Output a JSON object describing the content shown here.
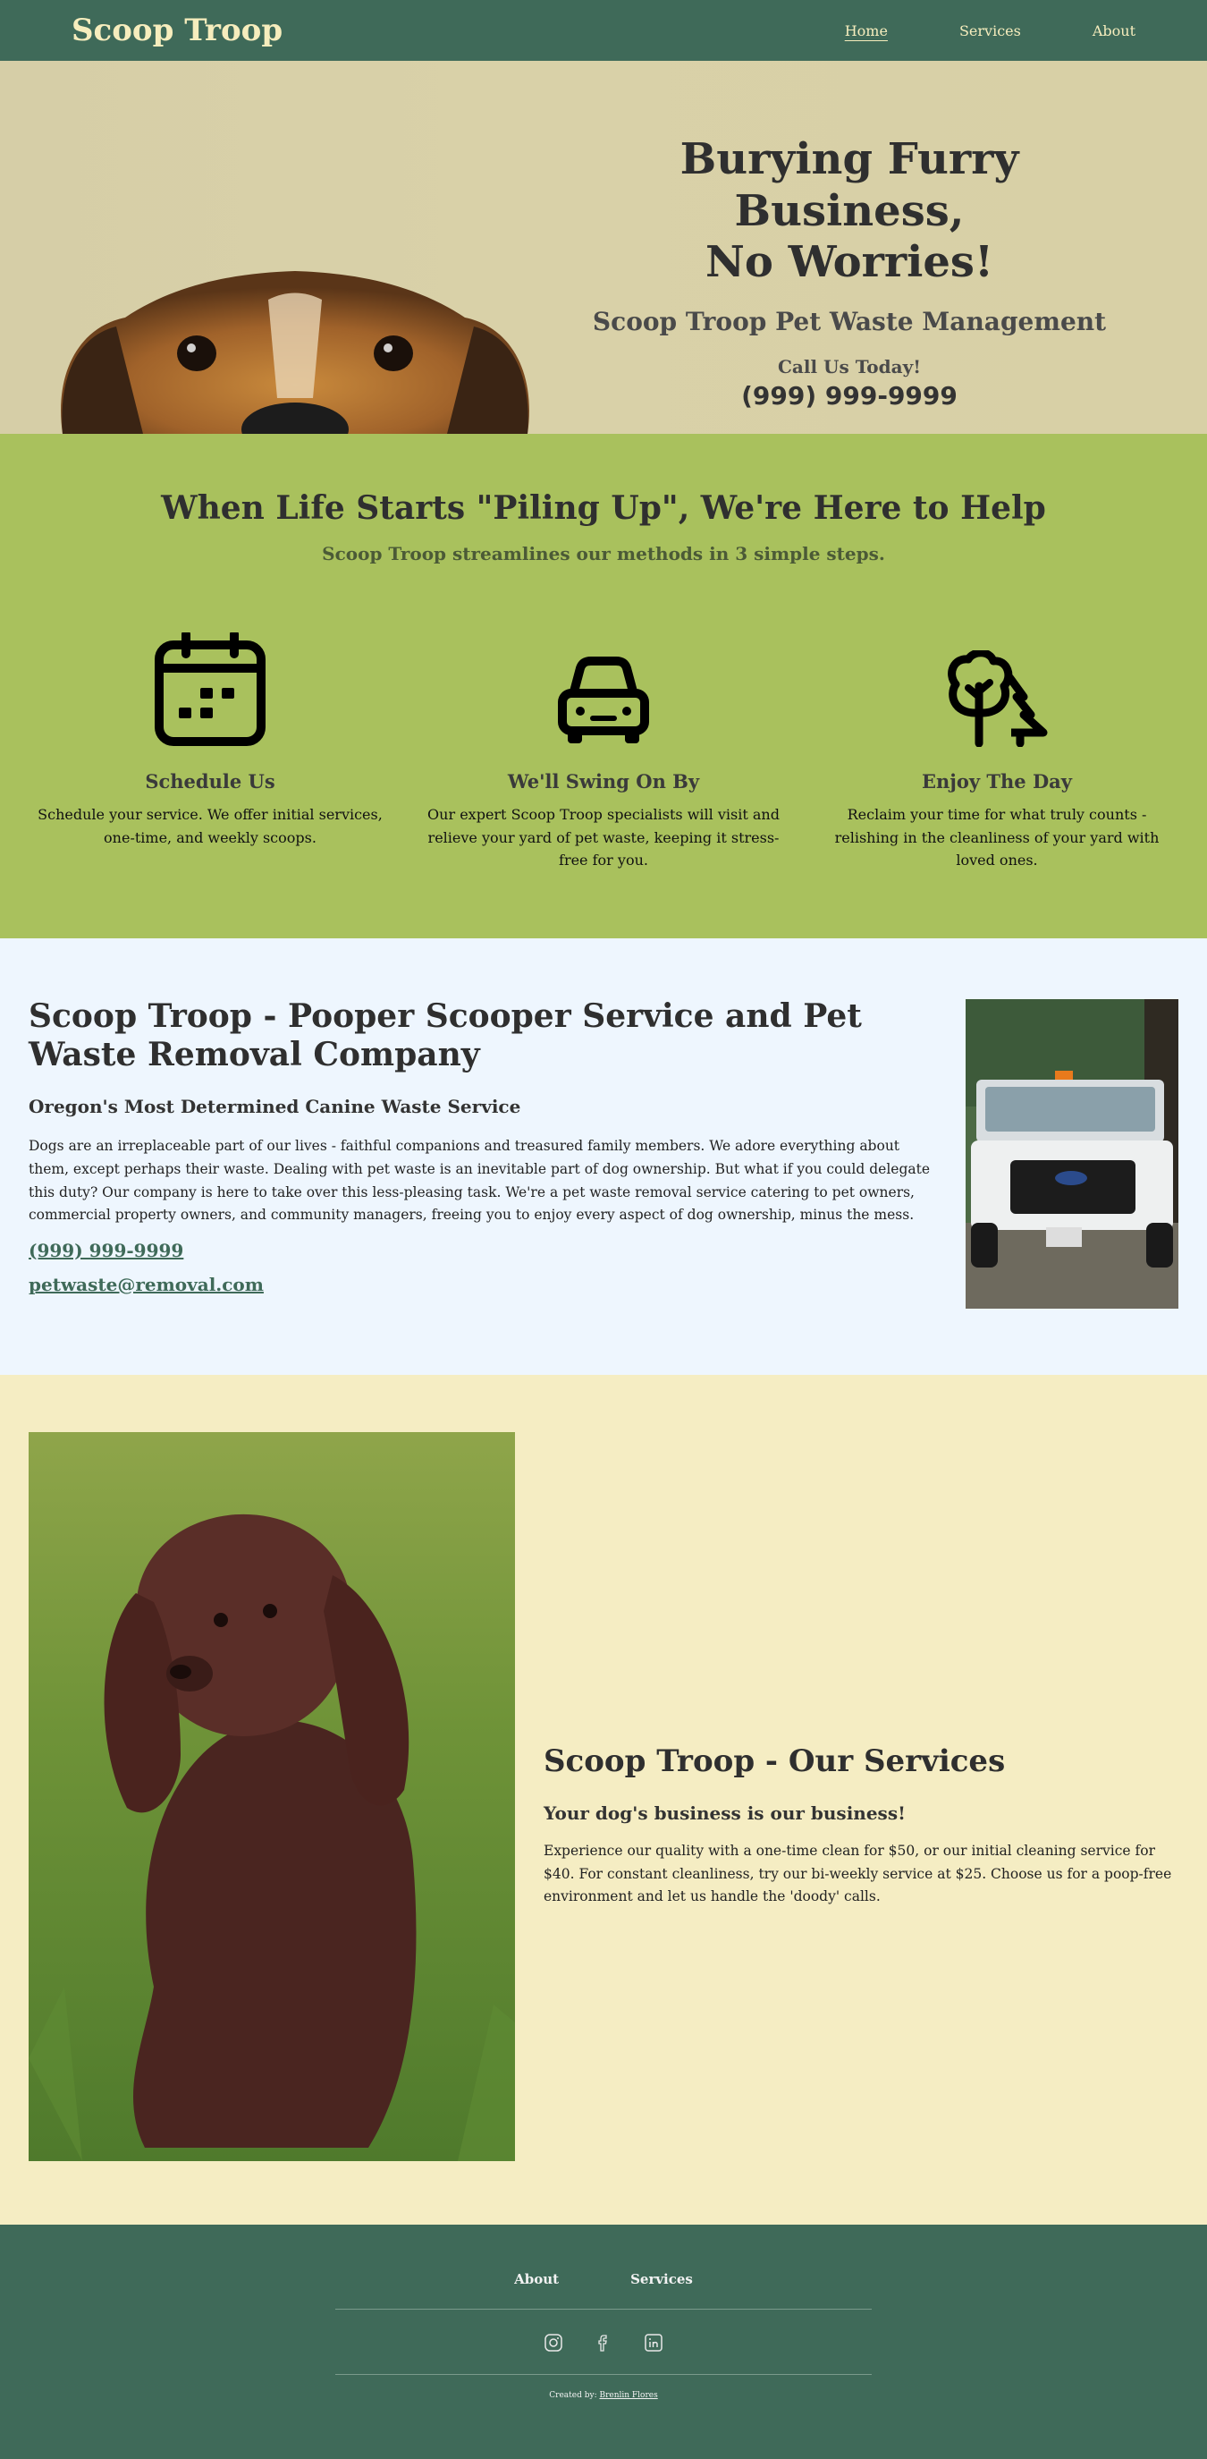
{
  "nav": {
    "brand": "Scoop Troop",
    "links": [
      "Home",
      "Services",
      "About"
    ]
  },
  "hero": {
    "title_line1": "Burying Furry Business,",
    "title_line2": "No Worries!",
    "subtitle": "Scoop Troop Pet Waste Management",
    "call": "Call Us Today!",
    "phone": "(999) 999-9999"
  },
  "steps": {
    "title": "When Life Starts \"Piling Up\", We're Here to Help",
    "subtitle": "Scoop Troop streamlines our methods in 3 simple steps.",
    "items": [
      {
        "icon": "calendar-icon",
        "title": "Schedule Us",
        "text": "Schedule your service. We offer initial services, one-time, and weekly scoops."
      },
      {
        "icon": "car-icon",
        "title": "We'll Swing On By",
        "text": "Our expert Scoop Troop specialists will visit and relieve your yard of pet waste, keeping it stress-free for you."
      },
      {
        "icon": "trees-icon",
        "title": "Enjoy The Day",
        "text": "Reclaim your time for what truly counts - relishing in the cleanliness of your yard with loved ones."
      }
    ]
  },
  "about": {
    "title": "Scoop Troop - Pooper Scooper Service and Pet Waste Removal Company",
    "subtitle": "Oregon's Most Determined Canine Waste Service",
    "body": "Dogs are an irreplaceable part of our lives - faithful companions and treasured family members. We adore everything about them, except perhaps their waste. Dealing with pet waste is an inevitable part of dog ownership. But what if you could delegate this duty? Our company is here to take over this less-pleasing task. We're a pet waste removal service catering to pet owners, commercial property owners, and community managers, freeing you to enjoy every aspect of dog ownership, minus the mess.",
    "phone": "(999) 999-9999",
    "email": "petwaste@removal.com"
  },
  "services": {
    "title": "Scoop Troop - Our Services",
    "subtitle": "Your dog's business is our business!",
    "body": "Experience our quality with a one-time clean for $50, or our initial cleaning service for $40. For constant cleanliness, try our bi-weekly service at $25. Choose us for a poop-free environment and let us handle the 'doody' calls."
  },
  "footer": {
    "links": [
      "About",
      "Services"
    ],
    "social": [
      "instagram-icon",
      "facebook-icon",
      "linkedin-icon"
    ],
    "credit_prefix": "Created by: ",
    "credit_name": "Brenlin Flores"
  },
  "colors": {
    "primary": "#3f6a59",
    "cream": "#f6edbd",
    "green_section": "#a9c15d",
    "light_blue": "#eef6fe",
    "services_bg": "#f5edc3"
  }
}
